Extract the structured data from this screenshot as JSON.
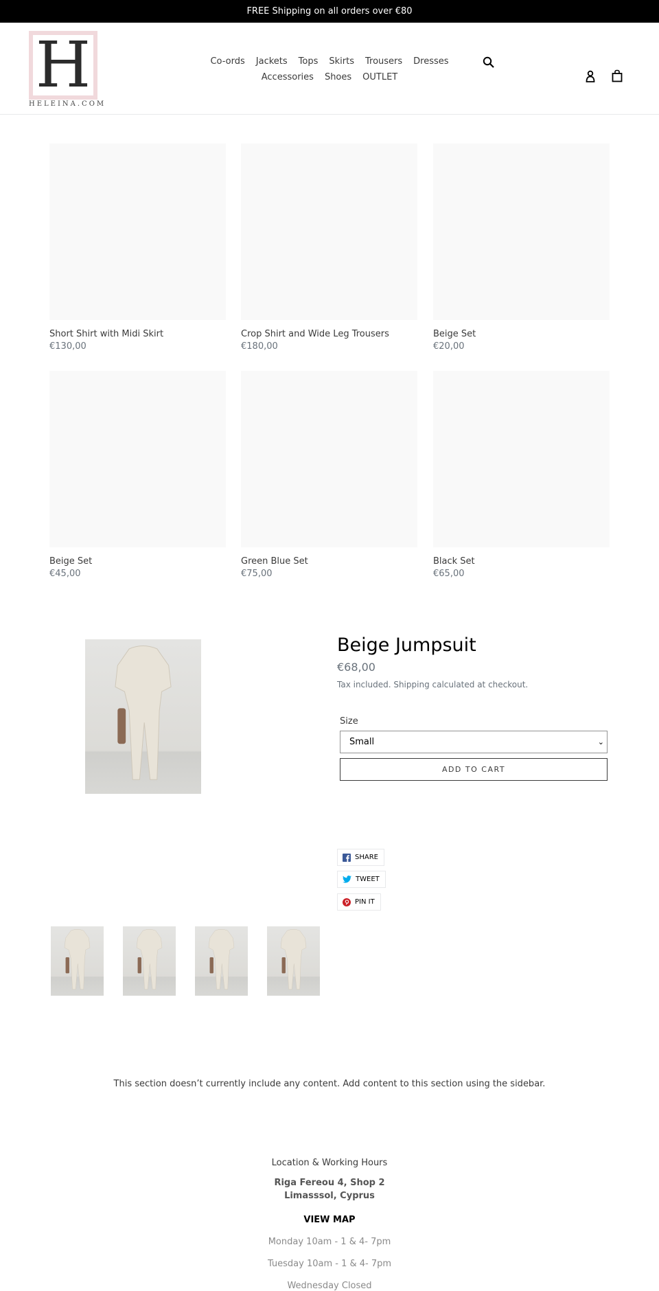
{
  "announcement": "FREE Shipping on all orders over €80",
  "logo": {
    "letter": "H",
    "text": "HELEINA.COM"
  },
  "nav": {
    "row1": [
      "Co-ords",
      "Jackets",
      "Tops",
      "Skirts",
      "Trousers",
      "Dresses"
    ],
    "row2": [
      "Accessories",
      "Shoes",
      "OUTLET"
    ]
  },
  "icons": {
    "search": "search-icon",
    "account": "user-icon",
    "cart": "shopping-bag-icon"
  },
  "products": [
    {
      "title": "Short Shirt with Midi Skirt",
      "price": "€130,00"
    },
    {
      "title": "Crop Shirt and Wide Leg Trousers",
      "price": "€180,00"
    },
    {
      "title": "Beige Set",
      "price": "€20,00"
    },
    {
      "title": "Beige Set",
      "price": "€45,00"
    },
    {
      "title": "Green Blue Set",
      "price": "€75,00"
    },
    {
      "title": "Black Set",
      "price": "€65,00"
    }
  ],
  "product": {
    "title": "Beige Jumpsuit",
    "price": "€68,00",
    "tax_note": "Tax included. Shipping calculated at checkout.",
    "size_label": "Size",
    "size_value": "Small",
    "add_to_cart": "ADD TO CART",
    "share": [
      "SHARE",
      "TWEET",
      "PIN IT"
    ],
    "thumbnail_count": 4
  },
  "empty_section": "This section doesn’t currently include any content. Add content to this section using the sidebar.",
  "footer": {
    "heading": "Location & Working Hours",
    "address1": "Riga Fereou 4, Shop 2",
    "address2": "Limasssol, Cyprus",
    "view_map": "VIEW MAP",
    "hours": [
      "Monday 10am - 1 & 4- 7pm",
      "Tuesday 10am - 1 & 4- 7pm",
      "Wednesday Closed"
    ]
  },
  "colors": {
    "facebook": "#3b5998",
    "twitter": "#00aced",
    "pinterest": "#cb2027",
    "logo_border": "#f1d9dc"
  }
}
